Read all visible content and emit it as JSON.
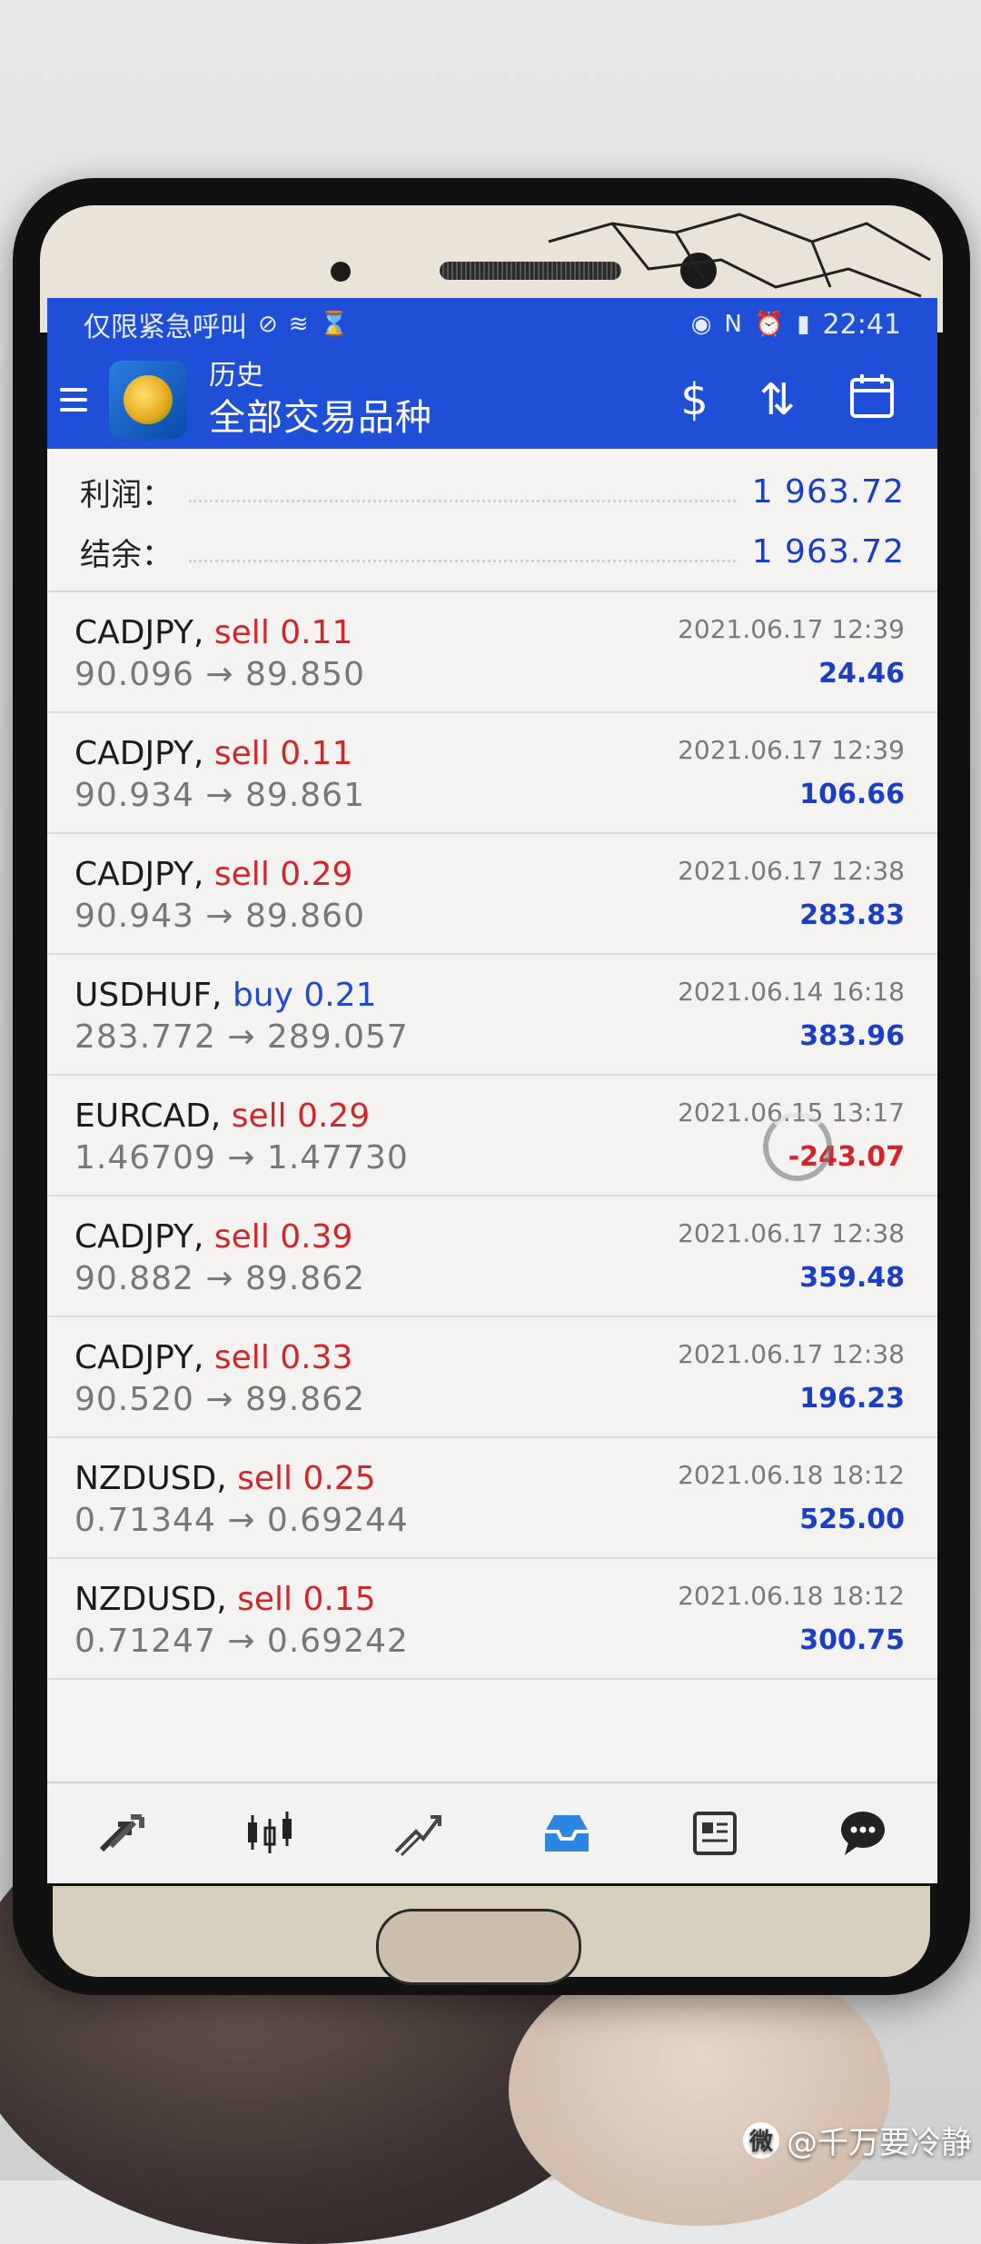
{
  "statusbar": {
    "left_text": "仅限紧急呼叫",
    "time": "22:41",
    "icons": [
      "no-signal-icon",
      "wifi-icon",
      "hourglass-icon",
      "eye-icon",
      "nfc-icon",
      "alarm-icon",
      "battery-icon"
    ]
  },
  "appbar": {
    "subtitle": "历史",
    "title": "全部交易品种",
    "actions": [
      "deposit-icon",
      "sort-icon",
      "calendar-icon"
    ]
  },
  "summary": {
    "profit_label": "利润：",
    "profit_value": "1 963.72",
    "balance_label": "结余：",
    "balance_value": "1 963.72"
  },
  "trades": [
    {
      "symbol": "CADJPY,",
      "type": "sell",
      "volume": "0.11",
      "prices": "90.096 → 89.850",
      "date": "2021.06.17 12:39",
      "profit": "24.46"
    },
    {
      "symbol": "CADJPY,",
      "type": "sell",
      "volume": "0.11",
      "prices": "90.934 → 89.861",
      "date": "2021.06.17 12:39",
      "profit": "106.66"
    },
    {
      "symbol": "CADJPY,",
      "type": "sell",
      "volume": "0.29",
      "prices": "90.943 → 89.860",
      "date": "2021.06.17 12:38",
      "profit": "283.83"
    },
    {
      "symbol": "USDHUF,",
      "type": "buy",
      "volume": "0.21",
      "prices": "283.772 → 289.057",
      "date": "2021.06.14 16:18",
      "profit": "383.96"
    },
    {
      "symbol": "EURCAD,",
      "type": "sell",
      "volume": "0.29",
      "prices": "1.46709 → 1.47730",
      "date": "2021.06.15 13:17",
      "profit": "-243.07"
    },
    {
      "symbol": "CADJPY,",
      "type": "sell",
      "volume": "0.39",
      "prices": "90.882 → 89.862",
      "date": "2021.06.17 12:38",
      "profit": "359.48"
    },
    {
      "symbol": "CADJPY,",
      "type": "sell",
      "volume": "0.33",
      "prices": "90.520 → 89.862",
      "date": "2021.06.17 12:38",
      "profit": "196.23"
    },
    {
      "symbol": "NZDUSD,",
      "type": "sell",
      "volume": "0.25",
      "prices": "0.71344 → 0.69244",
      "date": "2021.06.18 18:12",
      "profit": "525.00"
    },
    {
      "symbol": "NZDUSD,",
      "type": "sell",
      "volume": "0.15",
      "prices": "0.71247 → 0.69242",
      "date": "2021.06.18 18:12",
      "profit": "300.75"
    }
  ],
  "tabs": [
    "quotes-icon",
    "chart-icon",
    "trade-icon",
    "history-icon",
    "news-icon",
    "chat-icon"
  ],
  "active_tab": "history-icon",
  "colors": {
    "appbar": "#1f4fd6",
    "sell": "#d0262a",
    "buy": "#2149d0",
    "profit": "#1b3fc4"
  },
  "watermark": "@千万要冷静"
}
